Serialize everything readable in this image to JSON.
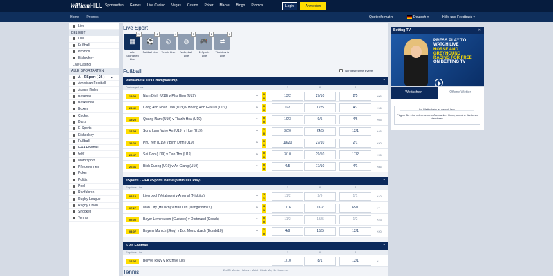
{
  "header": {
    "logo_main": "William",
    "logo_bold": "HILL",
    "nav": [
      "Sportwetten",
      "Games",
      "Live Casino",
      "Vegas",
      "Casino",
      "Poker",
      "Macau",
      "Bingo",
      "Promos"
    ],
    "login": "Login",
    "register": "Anmelden"
  },
  "subnav": {
    "items": [
      "Home",
      "Promos"
    ],
    "odds_format": "Quotenformat",
    "language": "Deutsch",
    "help": "Hilfe und Feedback"
  },
  "sidebar": {
    "top": [
      "Live"
    ],
    "beliebt_label": "BELIEBT",
    "beliebt": [
      "Live",
      "Fußball",
      "Promos",
      "Eishockey",
      "Live Casino"
    ],
    "all_label": "ALLE SPORTARTEN",
    "az": "A - Z Sport ( 26 )",
    "sports": [
      "American Football",
      "Aussie Rules",
      "Baseball",
      "Basketball",
      "Boxen",
      "Cricket",
      "Darts",
      "E-Sports",
      "Eishockey",
      "Fußball",
      "GAA Football",
      "Golf",
      "Motorsport",
      "Pferderennen",
      "Poker",
      "Politik",
      "Pool",
      "Radfahren",
      "Rugby League",
      "Rugby Union",
      "Snooker",
      "Tennis"
    ]
  },
  "main": {
    "title": "Live Sport",
    "tiles": [
      {
        "label": "Alle Sportarten Live",
        "count": "24"
      },
      {
        "label": "Fußball Live",
        "count": "12"
      },
      {
        "label": "Tennis Live",
        "count": "4"
      },
      {
        "label": "Volleyball Live",
        "count": "1"
      },
      {
        "label": "E-Sports Live",
        "count": "2"
      },
      {
        "label": "Tischtennis Live",
        "count": "5"
      }
    ],
    "section": "Fußball",
    "streams_label": "Nur gestreamte Events",
    "competitions": [
      {
        "name": "Vietnamese U19 Championship",
        "header_left": "Dreiwege Live",
        "cols": [
          "1",
          "X",
          "2"
        ],
        "events": [
          {
            "time": "19:00",
            "name": "Nam Dinh (U19) v Pho Hien (U19)",
            "s1": "0",
            "s2": "0",
            "o1": "13/2",
            "ox": "27/10",
            "o2": "2/5",
            "more": "+96"
          },
          {
            "time": "23:42",
            "name": "Cong Anh Nhan Dan (U19) v Hoang Anh Gia Lai (U19)",
            "s1": "0",
            "s2": "0",
            "o1": "1/2",
            "ox": "12/5",
            "o2": "4/7",
            "more": "+96"
          },
          {
            "time": "19:20",
            "name": "Quang Nam (U19) v Thanh Hoa (U19)",
            "s1": "0",
            "s2": "0",
            "o1": "10/3",
            "ox": "9/5",
            "o2": "4/6",
            "more": "+65"
          },
          {
            "time": "17:03",
            "name": "Song Lam Nghe An (U19) v Hue (U19)",
            "s1": "1",
            "s2": "0",
            "o1": "3/20",
            "ox": "24/5",
            "o2": "12/1",
            "more": "+46"
          },
          {
            "time": "22:20",
            "name": "Phu Yen (U19) v Binh Dinh (U19)",
            "s1": "0",
            "s2": "0",
            "o1": "19/20",
            "ox": "27/10",
            "o2": "2/1",
            "more": "+20"
          },
          {
            "time": "26:47",
            "name": "Sai Gon (U19) v Can Tho (U19)",
            "s1": "0",
            "s2": "0",
            "o1": "3/10",
            "ox": "29/10",
            "o2": "17/2",
            "more": "+95"
          },
          {
            "time": "26:31",
            "name": "Binh Duong (U19) v An Giang (U19)",
            "s1": "0",
            "s2": "0",
            "o1": "4/5",
            "ox": "17/10",
            "o2": "4/1",
            "more": "+86"
          }
        ]
      },
      {
        "name": "eSports - FIFA eSports Battle (8 Minutes Play)",
        "header_left": "Ergebnis Live",
        "cols": [
          "1",
          "X",
          "2"
        ],
        "events": [
          {
            "time": "08:10",
            "name": "Liverpool (Vetalmon) v Arsenal (Nikkitta)",
            "s1": "2",
            "s2": "1",
            "o1": "11/2",
            "ox": "2/9",
            "o2": "1/1",
            "more": "+10",
            "dim": true
          },
          {
            "time": "07:27",
            "name": "Man City (Hrusch) v Man Utd (Dangerdim77)",
            "s1": "3",
            "s2": "1",
            "o1": "1/16",
            "ox": "11/2",
            "o2": "65/1",
            "more": "+7"
          },
          {
            "time": "02:00",
            "name": "Bayer Leverkusen (Gustavo) v Dortmund (Kodak)",
            "s1": "0",
            "s2": "0",
            "o1": "11/2",
            "ox": "13/5",
            "o2": "1/2",
            "more": "+23",
            "dim": true
          },
          {
            "time": "03:07",
            "name": "Bayern Munich (Jkey) v Bor. Monch'bach (Bombi10)",
            "s1": "1",
            "s2": "0",
            "o1": "4/9",
            "ox": "13/5",
            "o2": "12/1",
            "more": "+20"
          }
        ]
      },
      {
        "name": "6 v 6 Football",
        "header_left": "Ergebnis Live",
        "cols": [
          "1",
          "X",
          "2"
        ],
        "events": [
          {
            "time": "17:07",
            "name": "Belyye Rozy v Ryzhiye Lisy",
            "s1": "",
            "s2": "",
            "o1": "1/10",
            "ox": "8/1",
            "o2": "12/1",
            "more": "+1"
          }
        ],
        "note": "2 x 20 Minute Halves - Match Clock May Be Incorrect"
      }
    ],
    "section2": "Tennis"
  },
  "right": {
    "tv_title": "Betting TV",
    "close": "✕",
    "promo_lines": [
      "PRESS PLAY TO WATCH LIVE",
      "HORSE AND GREYHOUND",
      "RACING FOR FREE",
      "ON BETTING TV"
    ],
    "tab_active": "Wettschein",
    "tab_other": "Offene Wetten",
    "slip_empty": "Ihr Wettschein ist derzeit leer.",
    "slip_hint": "Fügen Sie eine oder mehrere Auswahlen hinzu, um eine Wette zu platzieren."
  },
  "colors": {
    "navy": "#061c3e",
    "accent": "#ffde00",
    "panel": "#0c2a5c"
  }
}
